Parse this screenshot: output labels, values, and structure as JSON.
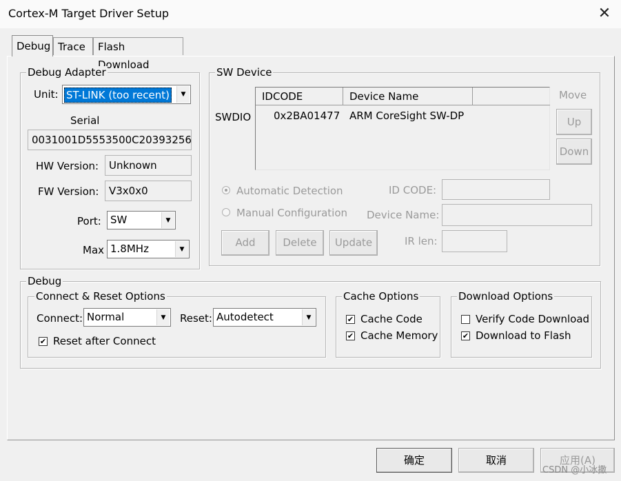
{
  "window": {
    "title": "Cortex-M Target Driver Setup",
    "close_glyph": "✕"
  },
  "tabs": [
    {
      "label": "Debug"
    },
    {
      "label": "Trace"
    },
    {
      "label": "Flash Download"
    }
  ],
  "debug_adapter": {
    "legend": "Debug Adapter",
    "unit_label": "Unit:",
    "unit_value": "ST-LINK (too recent)",
    "serial_label": "Serial",
    "serial_value": "0031001D5553500C20393256",
    "hw_label": "HW Version:",
    "hw_value": "Unknown",
    "fw_label": "FW Version:",
    "fw_value": "V3x0x0",
    "port_label": "Port:",
    "port_value": "SW",
    "max_label": "Max",
    "max_value": "1.8MHz"
  },
  "sw_device": {
    "legend": "SW Device",
    "row_label": "SWDIO",
    "col_idcode": "IDCODE",
    "col_device_name": "Device Name",
    "rows": [
      {
        "idcode": "0x2BA01477",
        "device_name": "ARM CoreSight SW-DP"
      }
    ],
    "move_label": "Move",
    "up_label": "Up",
    "down_label": "Down",
    "auto_detect_label": "Automatic Detection",
    "manual_config_label": "Manual Configuration",
    "id_code_label": "ID CODE:",
    "device_name_label": "Device Name:",
    "ir_len_label": "IR len:",
    "add_label": "Add",
    "delete_label": "Delete",
    "update_label": "Update"
  },
  "debug": {
    "legend": "Debug",
    "connect_reset": {
      "legend": "Connect & Reset Options",
      "connect_label": "Connect:",
      "connect_value": "Normal",
      "reset_label": "Reset:",
      "reset_value": "Autodetect",
      "reset_after_connect_label": "Reset after Connect",
      "reset_after_connect_checked": true
    },
    "cache": {
      "legend": "Cache Options",
      "cache_code_label": "Cache Code",
      "cache_code_checked": true,
      "cache_memory_label": "Cache Memory",
      "cache_memory_checked": true
    },
    "download": {
      "legend": "Download Options",
      "verify_label": "Verify Code Download",
      "verify_checked": false,
      "flash_label": "Download to Flash",
      "flash_checked": true
    }
  },
  "dialog_buttons": {
    "ok": "确定",
    "cancel": "取消",
    "apply": "应用(A)"
  },
  "watermark": "CSDN @小冰撒"
}
